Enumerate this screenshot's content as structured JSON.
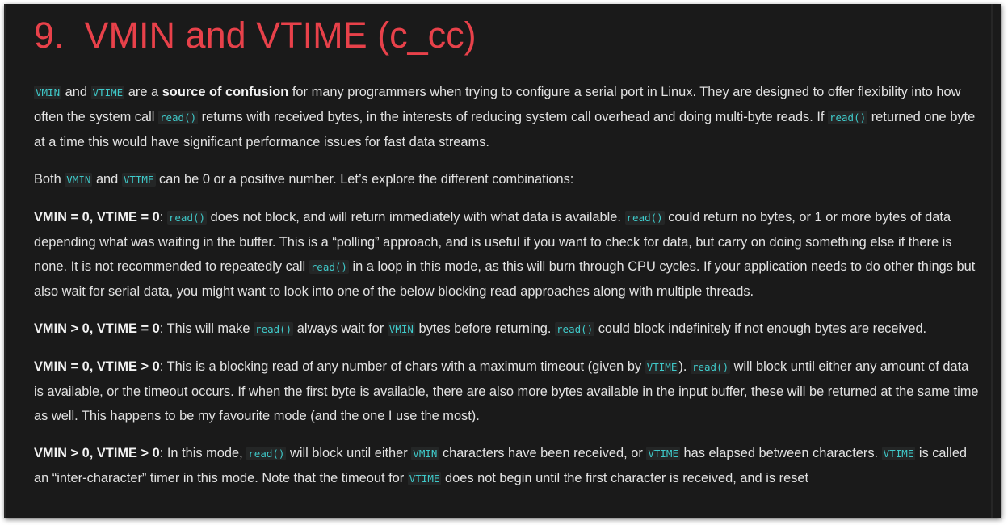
{
  "heading": {
    "number": "9.",
    "title": "VMIN and VTIME (c_cc)"
  },
  "para1": {
    "c_vmin": "VMIN",
    "t1": " and ",
    "c_vtime": "VTIME",
    "t2": " are a ",
    "bold": "source of confusion",
    "t3": " for many programmers when trying to configure a serial port in Linux. They are designed to offer flexibility into how often the system call ",
    "c_read1": "read()",
    "t4": " returns with received bytes, in the interests of reducing system call overhead and doing multi-byte reads. If ",
    "c_read2": "read()",
    "t5": " returned one byte at a time this would have significant performance issues for fast data streams."
  },
  "para2": {
    "t1": "Both ",
    "c_vmin": "VMIN",
    "t2": " and ",
    "c_vtime": "VTIME",
    "t3": " can be 0 or a positive number. Let’s explore the different combinations:"
  },
  "para3": {
    "bold": "VMIN = 0, VTIME = 0",
    "t1": ": ",
    "c_read1": "read()",
    "t2": " does not block, and will return immediately with what data is available. ",
    "c_read2": "read()",
    "t3": " could return no bytes, or 1 or more bytes of data depending what was waiting in the buffer. This is a “polling” approach, and is useful if you want to check for data, but carry on doing something else if there is none. It is not recommended to repeatedly call ",
    "c_read3": "read()",
    "t4": " in a loop in this mode, as this will burn through CPU cycles. If your application needs to do other things but also wait for serial data, you might want to look into one of the below blocking read approaches along with multiple threads."
  },
  "para4": {
    "bold": "VMIN > 0, VTIME = 0",
    "t1": ": This will make ",
    "c_read1": "read()",
    "t2": " always wait for ",
    "c_vmin": "VMIN",
    "t3": " bytes before returning. ",
    "c_read2": "read()",
    "t4": " could block indefinitely if not enough bytes are received."
  },
  "para5": {
    "bold": "VMIN = 0, VTIME > 0",
    "t1": ": This is a blocking read of any number of chars with a maximum timeout (given by ",
    "c_vtime": "VTIME",
    "t2": "). ",
    "c_read": "read()",
    "t3": " will block until either any amount of data is available, or the timeout occurs. If when the first byte is available, there are also more bytes available in the input buffer, these will be returned at the same time as well. This happens to be my favourite mode (and the one I use the most)."
  },
  "para6": {
    "bold": "VMIN > 0, VTIME > 0",
    "t1": ": In this mode, ",
    "c_read": "read()",
    "t2": " will block until either ",
    "c_vmin": "VMIN",
    "t3": " characters have been received, or ",
    "c_vtime1": "VTIME",
    "t4": " has elapsed between characters. ",
    "c_vtime2": "VTIME",
    "t5": " is called an “inter-character” timer in this mode. Note that the timeout for ",
    "c_vtime3": "VTIME",
    "t6": " does not begin until the first character is received, and is reset"
  }
}
